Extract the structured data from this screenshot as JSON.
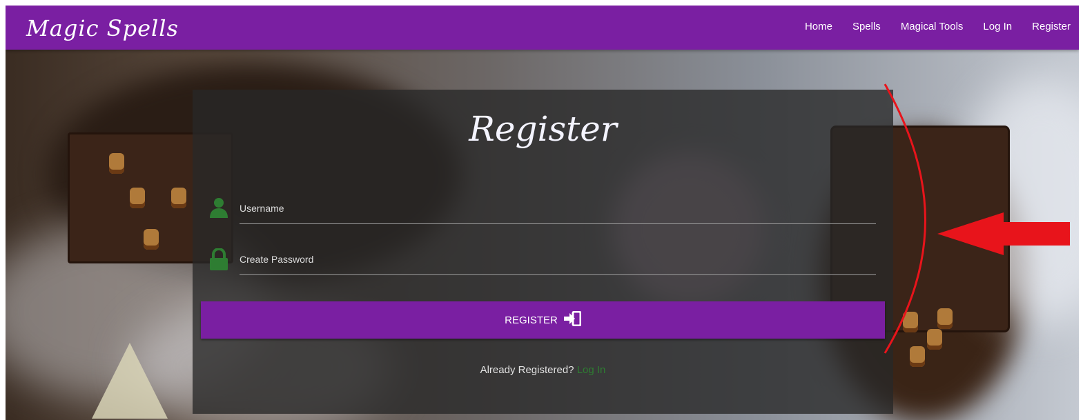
{
  "app": {
    "brand": "Magic Spells"
  },
  "nav": {
    "items": [
      "Home",
      "Spells",
      "Magical Tools",
      "Log In",
      "Register"
    ]
  },
  "form": {
    "title": "Register",
    "username_label": "Username",
    "password_label": "Create Password",
    "submit_label": "REGISTER",
    "already_text": "Already Registered?",
    "login_link": "Log In"
  },
  "icons": {
    "user": "user-icon",
    "lock": "lock-icon",
    "submit": "sign-in-icon"
  },
  "colors": {
    "primary": "#7a1fa2",
    "icon_green": "#2e7d32",
    "annotation_red": "#e8141b"
  }
}
